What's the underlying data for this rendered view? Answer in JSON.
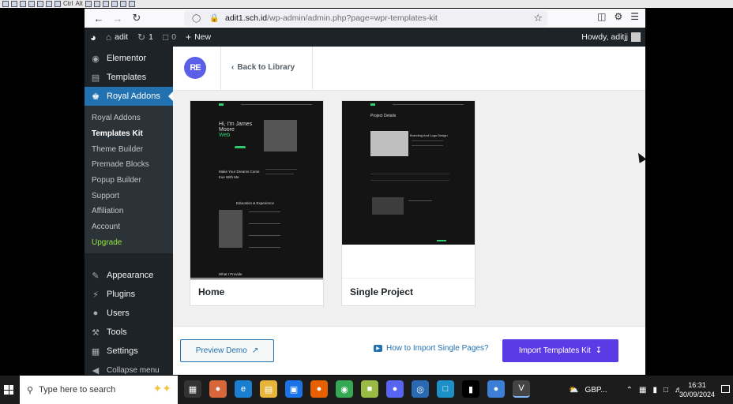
{
  "browser": {
    "url_host": "adit1.sch.id",
    "url_path": "/wp-admin/admin.php?page=wpr-templates-kit"
  },
  "adminbar": {
    "site_name": "adit",
    "updates_count": "1",
    "comments_count": "0",
    "new_label": "New",
    "howdy": "Howdy, aditjj"
  },
  "sidebar": {
    "top_items": [
      {
        "label": "Elementor",
        "icon": "elementor-icon"
      },
      {
        "label": "Templates",
        "icon": "folder-icon"
      },
      {
        "label": "Royal Addons",
        "icon": "crown-icon"
      }
    ],
    "sub_items": [
      "Royal Addons",
      "Templates Kit",
      "Theme Builder",
      "Premade Blocks",
      "Popup Builder",
      "Support",
      "Affiliation",
      "Account",
      "Upgrade"
    ],
    "bottom_items": [
      {
        "label": "Appearance",
        "icon": "brush-icon"
      },
      {
        "label": "Plugins",
        "icon": "plug-icon"
      },
      {
        "label": "Users",
        "icon": "user-icon"
      },
      {
        "label": "Tools",
        "icon": "wrench-icon"
      },
      {
        "label": "Settings",
        "icon": "settings-icon"
      },
      {
        "label": "Collapse menu",
        "icon": "collapse-icon"
      }
    ]
  },
  "header": {
    "logo_text": "RE",
    "back_label": "Back to Library"
  },
  "cards": [
    {
      "title": "Home",
      "thumb": {
        "hero_line1": "Hi, I'm James",
        "hero_line2": "Moore",
        "hero_line3": "Web",
        "section1": "Make Your Dreams Come true With Me",
        "section2": "Education & Experience",
        "section3": "What I Provide"
      }
    },
    {
      "title": "Single Project",
      "thumb": {
        "heading": "Project Details",
        "sub": "Branding And Logo Design"
      }
    }
  ],
  "footer": {
    "preview_label": "Preview Demo",
    "howto_label": "How to Import Single Pages?",
    "import_label": "Import Templates Kit"
  },
  "taskbar": {
    "search_placeholder": "Type here to search",
    "weather": "GBP...",
    "time": "16:31",
    "date": "30/09/2024"
  },
  "colors": {
    "wp_dark": "#1d2327",
    "wp_blue": "#2271b1",
    "royal_purple": "#5b3be6",
    "upgrade_green": "#93e53b"
  }
}
